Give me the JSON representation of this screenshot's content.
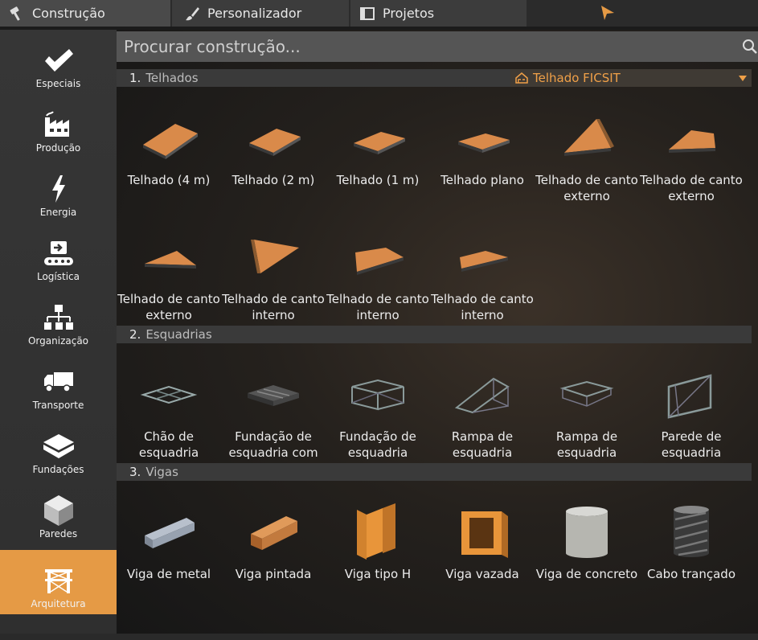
{
  "tabs": [
    {
      "label": "Construção",
      "icon": "hammer-icon"
    },
    {
      "label": "Personalizador",
      "icon": "brush-icon"
    },
    {
      "label": "Projetos",
      "icon": "blueprint-icon"
    }
  ],
  "sidebar": {
    "items": [
      {
        "label": "Especiais",
        "icon": "checkmark-icon"
      },
      {
        "label": "Produção",
        "icon": "factory-icon"
      },
      {
        "label": "Energia",
        "icon": "lightning-icon"
      },
      {
        "label": "Logística",
        "icon": "conveyor-icon"
      },
      {
        "label": "Organização",
        "icon": "hierarchy-icon"
      },
      {
        "label": "Transporte",
        "icon": "truck-icon"
      },
      {
        "label": "Fundações",
        "icon": "foundation-icon"
      },
      {
        "label": "Paredes",
        "icon": "wall-icon"
      },
      {
        "label": "Arquitetura",
        "icon": "scaffold-icon"
      }
    ],
    "active_index": 8
  },
  "search": {
    "placeholder": "Procurar construção..."
  },
  "categories": [
    {
      "number": "1.",
      "name": "Telhados"
    },
    {
      "number": "2.",
      "name": "Esquadrias"
    },
    {
      "number": "3.",
      "name": "Vigas"
    }
  ],
  "material_dropdown": {
    "selected": "Telhado FICSIT"
  },
  "items": {
    "telhados": [
      "Telhado (4 m)",
      "Telhado (2 m)",
      "Telhado (1 m)",
      "Telhado plano",
      "Telhado de canto externo",
      "Telhado de canto externo",
      "Telhado de canto externo",
      "Telhado de canto interno",
      "Telhado de canto interno",
      "Telhado de canto interno"
    ],
    "esquadrias": [
      "Chão de esquadria",
      "Fundação de esquadria com",
      "Fundação de esquadria",
      "Rampa de esquadria",
      "Rampa de esquadria",
      "Parede de esquadria"
    ],
    "vigas": [
      "Viga de metal",
      "Viga pintada",
      "Viga tipo H",
      "Viga vazada",
      "Viga de concreto",
      "Cabo trançado"
    ]
  },
  "colors": {
    "accent": "#e59a45",
    "roof": "#d98a4a"
  }
}
